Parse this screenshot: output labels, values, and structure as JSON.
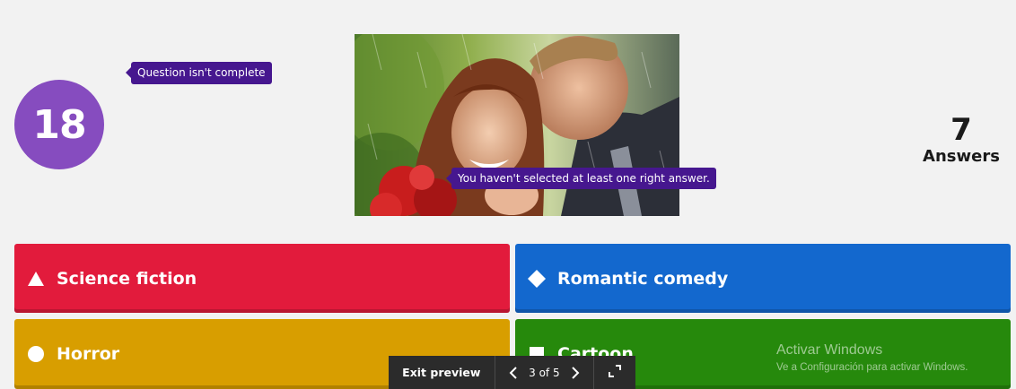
{
  "timer": {
    "value": "18"
  },
  "tooltips": {
    "question_incomplete": "Question isn't complete",
    "answer_missing": "You haven't selected at least one right answer."
  },
  "answers_count": {
    "number": "7",
    "label": "Answers"
  },
  "answers": [
    {
      "shape": "triangle-icon",
      "label": "Science fiction",
      "color": "#e21b3c"
    },
    {
      "shape": "diamond-icon",
      "label": "Romantic comedy",
      "color": "#1368ce"
    },
    {
      "shape": "circle-icon",
      "label": "Horror",
      "color": "#d89e00"
    },
    {
      "shape": "square-icon",
      "label": "Cartoon",
      "color": "#26890c"
    }
  ],
  "preview_bar": {
    "exit_label": "Exit preview",
    "page_indicator": "3 of 5"
  },
  "watermark": {
    "title": "Activar Windows",
    "subtitle": "Ve a Configuración para activar Windows."
  },
  "colors": {
    "timer": "#864cbf",
    "tooltip": "#46178f",
    "background": "#f2f2f2"
  }
}
